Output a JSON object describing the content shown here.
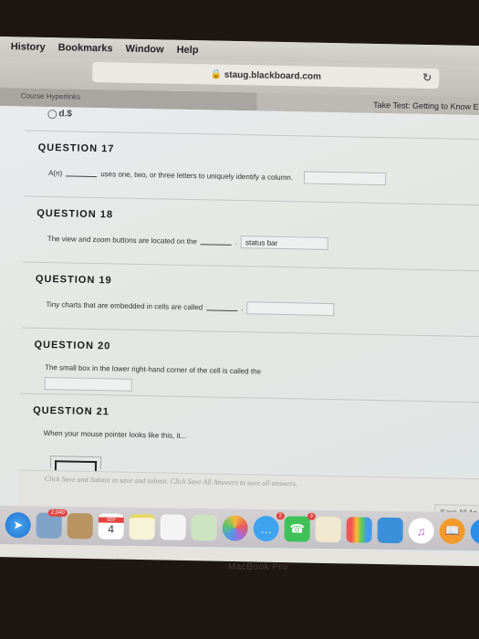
{
  "menubar": {
    "items": [
      "History",
      "Bookmarks",
      "Window",
      "Help"
    ]
  },
  "browser": {
    "url": "staug.blackboard.com",
    "tabs": [
      "Course Hyperlinks",
      "Take Test: Getting to Know Exce"
    ]
  },
  "prev_option": {
    "label": "d.$"
  },
  "questions": [
    {
      "title": "QUESTION 17",
      "pre": "A(n)",
      "post": "uses one, two, or three letters to uniquely identify a column.",
      "answer": ""
    },
    {
      "title": "QUESTION 18",
      "pre": "The view and zoom buttons are located on the",
      "post": ".",
      "answer": "status bar"
    },
    {
      "title": "QUESTION 19",
      "pre": "Tiny charts that are embedded in cells are called",
      "post": ".",
      "answer": ""
    },
    {
      "title": "QUESTION 20",
      "pre": "The small box in the lower right-hand corner of the cell is called the",
      "post": "",
      "answer": ""
    },
    {
      "title": "QUESTION 21",
      "pre": "When your mouse pointer looks like this, it...",
      "post": "",
      "answer": ""
    }
  ],
  "footer": {
    "note": "Click Save and Submit to save and submit. Click Save All Answers to save all answers.",
    "save_all": "Save All An"
  },
  "dock": {
    "badges": {
      "photos": "2,040",
      "messages": "2",
      "facetime": "3"
    },
    "calendar": {
      "month": "SEP",
      "day": "4"
    }
  },
  "bezel": {
    "label": "MacBook Pro"
  }
}
